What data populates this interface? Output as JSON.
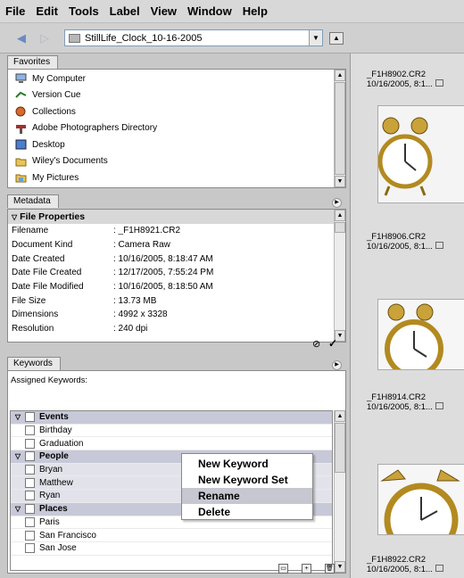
{
  "menu": [
    "File",
    "Edit",
    "Tools",
    "Label",
    "View",
    "Window",
    "Help"
  ],
  "toolbar": {
    "path": "StillLife_Clock_10-16-2005"
  },
  "favorites": {
    "tab": "Favorites",
    "items": [
      {
        "label": "My Computer",
        "icon": "computer-icon"
      },
      {
        "label": "Version Cue",
        "icon": "version-cue-icon"
      },
      {
        "label": "Collections",
        "icon": "collections-icon"
      },
      {
        "label": "Adobe Photographers Directory",
        "icon": "photographers-icon"
      },
      {
        "label": "Desktop",
        "icon": "desktop-icon"
      },
      {
        "label": "Wiley's Documents",
        "icon": "folder-icon"
      },
      {
        "label": "My Pictures",
        "icon": "pictures-icon"
      }
    ]
  },
  "metadata": {
    "tab": "Metadata",
    "section": "File Properties",
    "rows": [
      {
        "k": "Filename",
        "v": ": _F1H8921.CR2"
      },
      {
        "k": "Document Kind",
        "v": ": Camera Raw"
      },
      {
        "k": "Date Created",
        "v": ": 10/16/2005, 8:18:47 AM"
      },
      {
        "k": "Date File Created",
        "v": ": 12/17/2005, 7:55:24 PM"
      },
      {
        "k": "Date File Modified",
        "v": ": 10/16/2005, 8:18:50 AM"
      },
      {
        "k": "File Size",
        "v": ": 13.73 MB"
      },
      {
        "k": "Dimensions",
        "v": ": 4992 x 3328"
      },
      {
        "k": "Resolution",
        "v": ": 240 dpi"
      }
    ]
  },
  "keywords": {
    "tab": "Keywords",
    "assigned_label": "Assigned Keywords:",
    "rows": [
      {
        "label": "Events",
        "cat": true
      },
      {
        "label": "Birthday",
        "cat": false
      },
      {
        "label": "Graduation",
        "cat": false
      },
      {
        "label": "People",
        "cat": true
      },
      {
        "label": "Bryan",
        "cat": false
      },
      {
        "label": "Matthew",
        "cat": false
      },
      {
        "label": "Ryan",
        "cat": false
      },
      {
        "label": "Places",
        "cat": true
      },
      {
        "label": "Paris",
        "cat": false
      },
      {
        "label": "San Francisco",
        "cat": false
      },
      {
        "label": "San Jose",
        "cat": false
      }
    ]
  },
  "context_menu": [
    "New Keyword",
    "New Keyword Set",
    "Rename",
    "Delete"
  ],
  "context_menu_highlighted": "Rename",
  "thumbnails": [
    {
      "name": "_F1H8902.CR2",
      "date": "10/16/2005, 8:1..."
    },
    {
      "name": "_F1H8906.CR2",
      "date": "10/16/2005, 8:1..."
    },
    {
      "name": "_F1H8914.CR2",
      "date": "10/16/2005, 8:1..."
    },
    {
      "name": "_F1H8922.CR2",
      "date": "10/16/2005, 8:1..."
    }
  ]
}
